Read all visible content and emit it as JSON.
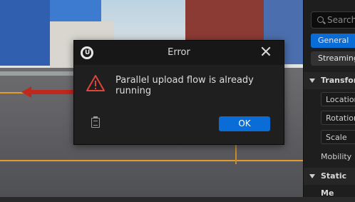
{
  "dialog": {
    "title": "Error",
    "message": "Parallel upload flow is already running",
    "ok_label": "OK"
  },
  "details": {
    "search_placeholder": "Search",
    "tabs": [
      {
        "label": "General"
      },
      {
        "label": "Streaming"
      }
    ],
    "sections": {
      "transform": "Transform",
      "static_mesh": "Static Me"
    },
    "properties": {
      "location": "Location",
      "rotation": "Rotation",
      "scale": "Scale",
      "mobility": "Mobility"
    }
  },
  "colors": {
    "accent": "#0a6cd6",
    "warning": "#e0453a"
  }
}
